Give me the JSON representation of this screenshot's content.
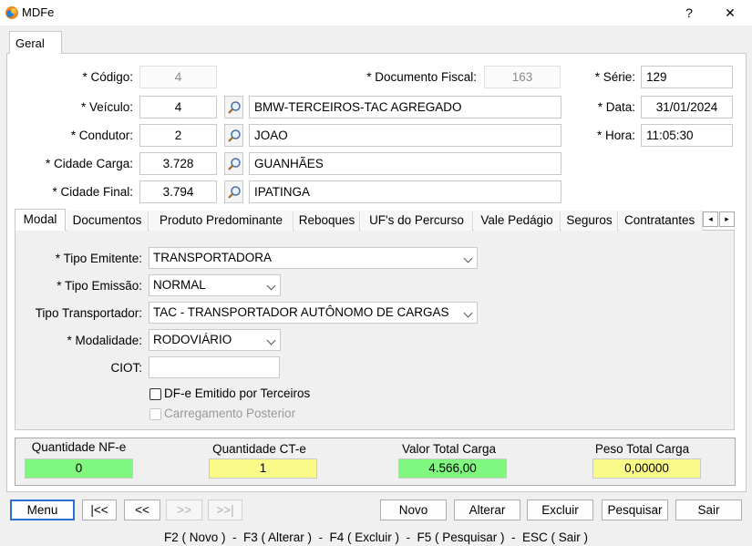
{
  "window": {
    "title": "MDFe",
    "help_label": "?",
    "close_label": "✕"
  },
  "outer_tab": {
    "label": "Geral"
  },
  "header_form": {
    "codigo": {
      "label": "* Código:",
      "value": "4"
    },
    "documento_fiscal": {
      "label": "* Documento Fiscal:",
      "value": "163"
    },
    "serie": {
      "label": "* Série:",
      "value": "129"
    },
    "veiculo": {
      "label": "* Veículo:",
      "code": "4",
      "description": "BMW-TERCEIROS-TAC AGREGADO"
    },
    "data": {
      "label": "* Data:",
      "value": "31/01/2024"
    },
    "condutor": {
      "label": "* Condutor:",
      "code": "2",
      "description": "JOAO"
    },
    "hora": {
      "label": "* Hora:",
      "value": "11:05:30"
    },
    "cidade_carga": {
      "label": "* Cidade Carga:",
      "code": "3.728",
      "description": "GUANHÃES"
    },
    "cidade_final": {
      "label": "* Cidade Final:",
      "code": "3.794",
      "description": "IPATINGA"
    }
  },
  "inner_tabs": [
    {
      "label": "Modal"
    },
    {
      "label": "Documentos"
    },
    {
      "label": "Produto Predominante"
    },
    {
      "label": "Reboques"
    },
    {
      "label": "UF's do Percurso"
    },
    {
      "label": "Vale Pedágio"
    },
    {
      "label": "Seguros"
    },
    {
      "label": "Contratantes"
    }
  ],
  "tab_scroll": {
    "left": "◂",
    "right": "▸"
  },
  "modal_form": {
    "tipo_emitente": {
      "label": "* Tipo Emitente:",
      "value": "TRANSPORTADORA"
    },
    "tipo_emissao": {
      "label": "* Tipo Emissão:",
      "value": "NORMAL"
    },
    "tipo_transportador": {
      "label": "Tipo Transportador:",
      "value": "TAC - TRANSPORTADOR AUTÔNOMO DE CARGAS"
    },
    "modalidade": {
      "label": "* Modalidade:",
      "value": "RODOVIÁRIO"
    },
    "ciot": {
      "label": "CIOT:",
      "value": ""
    },
    "dfe_terceiros": {
      "label": "DF-e Emitido por Terceiros",
      "checked": false
    },
    "carregamento_posterior": {
      "label": "Carregamento Posterior",
      "checked": false,
      "disabled": true
    }
  },
  "totals": [
    {
      "label": "Quantidade NF-e",
      "value": "0",
      "color": "#80f880"
    },
    {
      "label": "Quantidade CT-e",
      "value": "1",
      "color": "#fafa88"
    },
    {
      "label": "Valor Total Carga",
      "value": "4.566,00",
      "color": "#80f880"
    },
    {
      "label": "Peso Total Carga",
      "value": "0,00000",
      "color": "#fafa88"
    }
  ],
  "nav_buttons": {
    "menu": "Menu",
    "first": "|<<",
    "prev": "<<",
    "next": ">>",
    "last": ">>|"
  },
  "action_buttons": {
    "novo": "Novo",
    "alterar": "Alterar",
    "excluir": "Excluir",
    "pesquisar": "Pesquisar",
    "sair": "Sair"
  },
  "status_bar": "F2 ( Novo )  -  F3 ( Alterar )  -  F4 ( Excluir )  -  F5 ( Pesquisar )  -  ESC ( Sair )"
}
